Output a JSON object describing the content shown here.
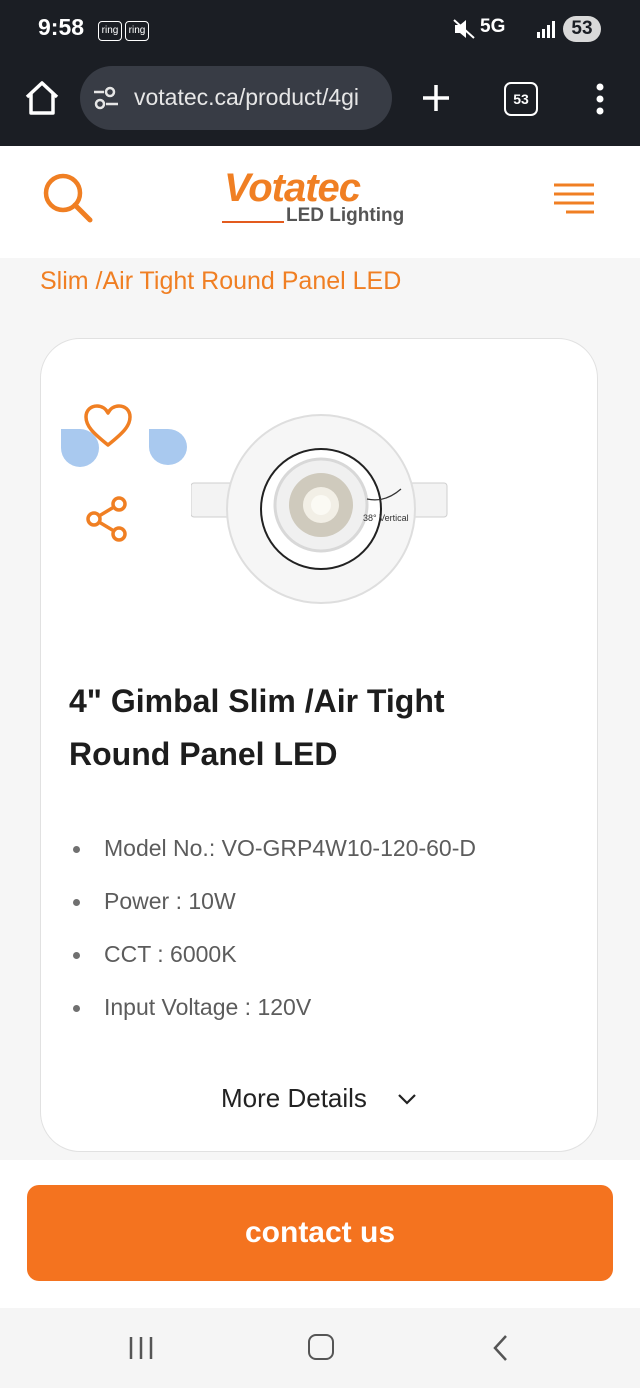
{
  "status": {
    "time": "9:58",
    "notif_badges": [
      "ring",
      "ring"
    ],
    "network": "5G",
    "battery": "53"
  },
  "browser": {
    "url": "votatec.ca/product/4gi",
    "tab_count": "53"
  },
  "header": {
    "logo_main": "Votatec",
    "logo_sub": "LED Lighting",
    "brand_color": "#f07f23"
  },
  "breadcrumb": {
    "current": "Slim /Air Tight Round Panel LED"
  },
  "product": {
    "title": "4\" Gimbal Slim /Air Tight Round Panel LED",
    "image_label": "38° Vertical",
    "specs": [
      "Model No.: VO-GRP4W10-120-60-D",
      "Power : 10W",
      "CCT : 6000K",
      "Input Voltage : 120V"
    ],
    "more_details": "More Details"
  },
  "cta": {
    "contact": "contact us",
    "color": "#f4731f"
  }
}
